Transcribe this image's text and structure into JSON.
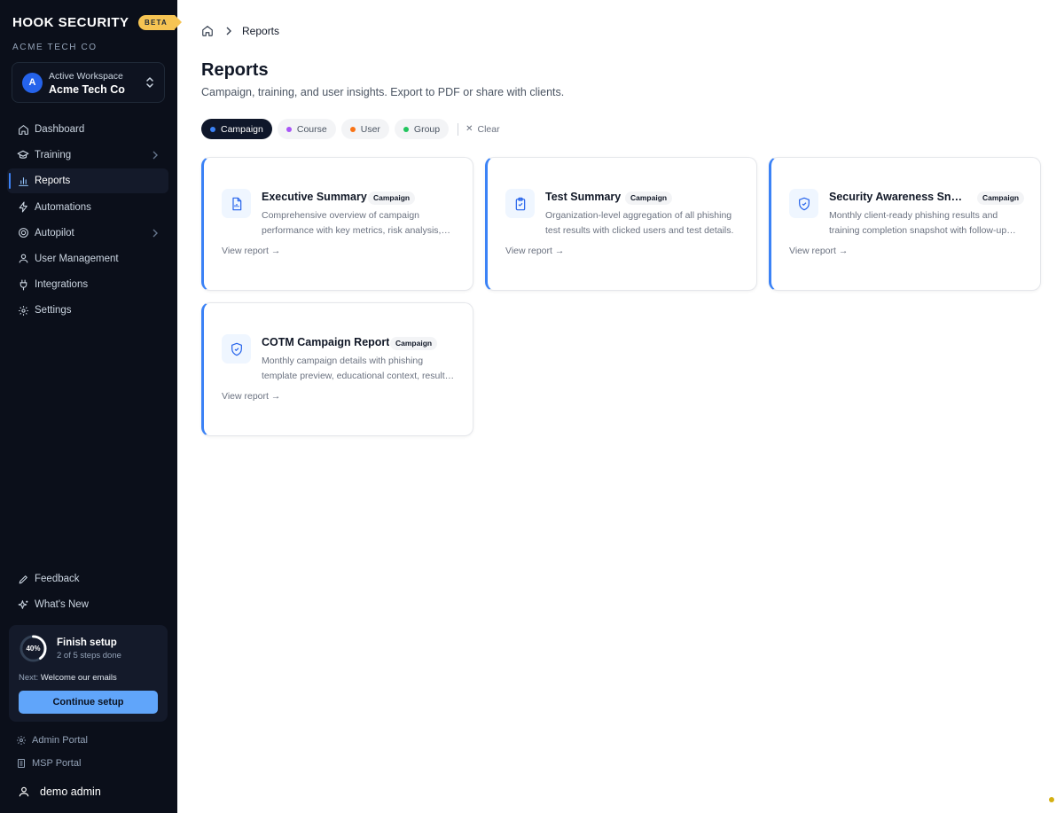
{
  "sidebar": {
    "brand": "HOOK SECURITY",
    "beta": "BETA",
    "org": "ACME TECH CO",
    "workspace": {
      "avatar": "A",
      "label": "Active Workspace",
      "name": "Acme Tech Co"
    },
    "nav": [
      {
        "label": "Dashboard",
        "icon": "home-icon"
      },
      {
        "label": "Training",
        "icon": "graduation-cap-icon",
        "has_submenu": true
      },
      {
        "label": "Reports",
        "icon": "bar-chart-icon",
        "active": true
      },
      {
        "label": "Automations",
        "icon": "zap-icon"
      },
      {
        "label": "Autopilot",
        "icon": "target-icon",
        "has_submenu": true
      },
      {
        "label": "User Management",
        "icon": "user-icon"
      },
      {
        "label": "Integrations",
        "icon": "plug-icon"
      },
      {
        "label": "Settings",
        "icon": "gear-icon"
      }
    ],
    "bottom_nav": [
      {
        "label": "Feedback",
        "icon": "pencil-icon"
      },
      {
        "label": "What's New",
        "icon": "sparkles-icon"
      }
    ],
    "setup": {
      "progress_percent": 40,
      "progress_label": "40%",
      "title": "Finish setup",
      "subtitle": "2 of 5 steps done",
      "next_prefix": "Next:",
      "next_step": "Welcome our emails",
      "button": "Continue setup"
    },
    "portals": [
      {
        "label": "Admin Portal",
        "icon": "gear-icon"
      },
      {
        "label": "MSP Portal",
        "icon": "building-icon"
      }
    ],
    "user": "demo admin"
  },
  "breadcrumb": {
    "current": "Reports"
  },
  "header": {
    "title": "Reports",
    "subtitle": "Campaign, training, and user insights. Export to PDF or share with clients."
  },
  "filters": [
    {
      "label": "Campaign",
      "color": "#3b82f6",
      "active": true
    },
    {
      "label": "Course",
      "color": "#a855f7",
      "active": false
    },
    {
      "label": "User",
      "color": "#f97316",
      "active": false
    },
    {
      "label": "Group",
      "color": "#22c55e",
      "active": false
    }
  ],
  "clear_label": "Clear",
  "cards": [
    {
      "title": "Executive Summary",
      "badge": "Campaign",
      "icon": "document-chart-icon",
      "description": "Comprehensive overview of campaign performance with key metrics, risk analysis, and recommendations.",
      "link": "View report →"
    },
    {
      "title": "Test Summary",
      "badge": "Campaign",
      "icon": "clipboard-check-icon",
      "description": "Organization-level aggregation of all phishing test results with clicked users and test details.",
      "link": "View report →"
    },
    {
      "title": "Security Awareness Snapshot",
      "badge": "Campaign",
      "icon": "shield-check-icon",
      "description": "Monthly client-ready phishing results and training completion snapshot with follow-up actions.",
      "link": "View report →"
    },
    {
      "title": "COTM Campaign Report",
      "badge": "Campaign",
      "icon": "shield-check-icon",
      "description": "Monthly campaign details with phishing template preview, educational context, results and more.",
      "link": "View report →"
    }
  ],
  "colors": {
    "sidebar_bg": "#0b0f1a",
    "accent": "#3b82f6",
    "beta_badge": "#f6c453",
    "setup_button": "#60a5fa"
  }
}
